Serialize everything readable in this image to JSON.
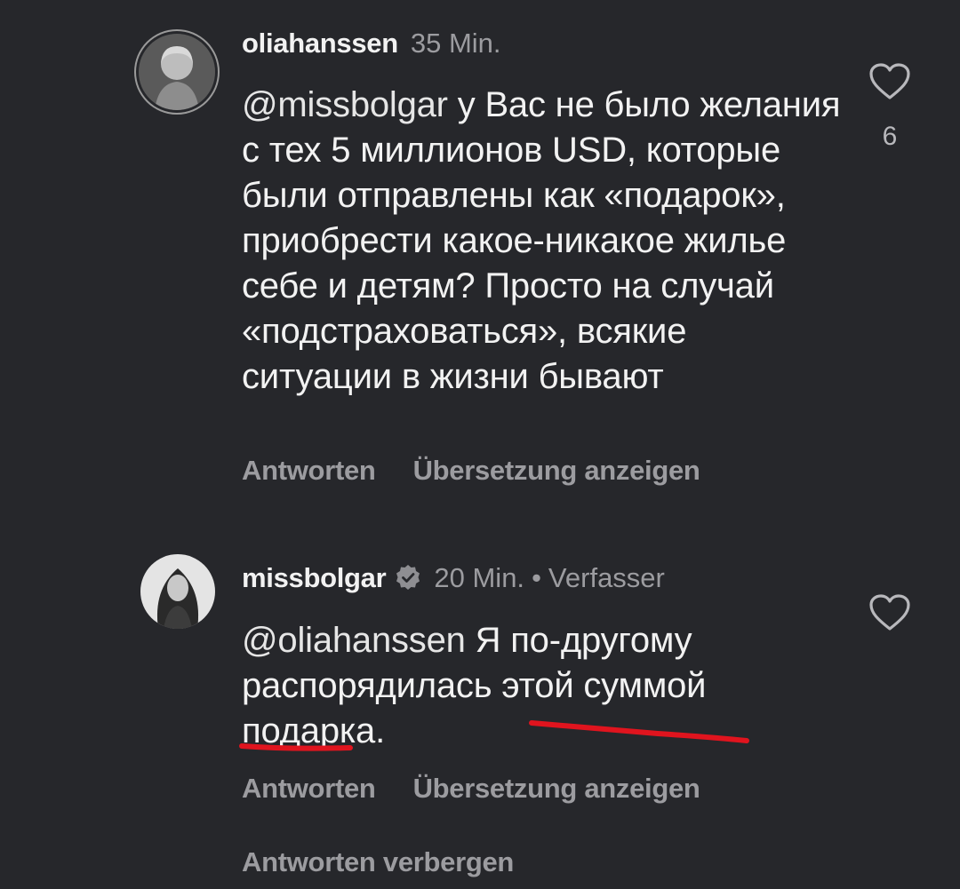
{
  "comments": [
    {
      "username": "oliahanssen",
      "time": "35 Min.",
      "mention": "@missbolgar",
      "text": " у Вас не было желания с тех 5 миллионов USD, которые были отправлены как «подарок», приобрести какое-никакое жилье себе и детям? Просто на случай «подстраховаться», всякие ситуации в жизни бывают",
      "likes": "6",
      "reply_label": "Antworten",
      "translate_label": "Übersetzung anzeigen",
      "avatar_icon": "avatar-photo-icon"
    },
    {
      "username": "missbolgar",
      "verified": true,
      "time": "20 Min.",
      "separator": "•",
      "author_tag": "Verfasser",
      "mention": "@oliahanssen",
      "text": " Я по-другому распорядилась этой суммой подарка.",
      "reply_label": "Antworten",
      "translate_label": "Übersetzung anzeigen",
      "avatar_icon": "avatar-photo-icon"
    }
  ],
  "hide_replies_label": "Antworten verbergen",
  "colors": {
    "background": "#26272b",
    "text": "#f2f2f2",
    "muted": "#9c9ca0",
    "annotation": "#e0141e"
  },
  "icons": {
    "like": "heart-outline-icon",
    "verified": "verified-badge-icon"
  }
}
